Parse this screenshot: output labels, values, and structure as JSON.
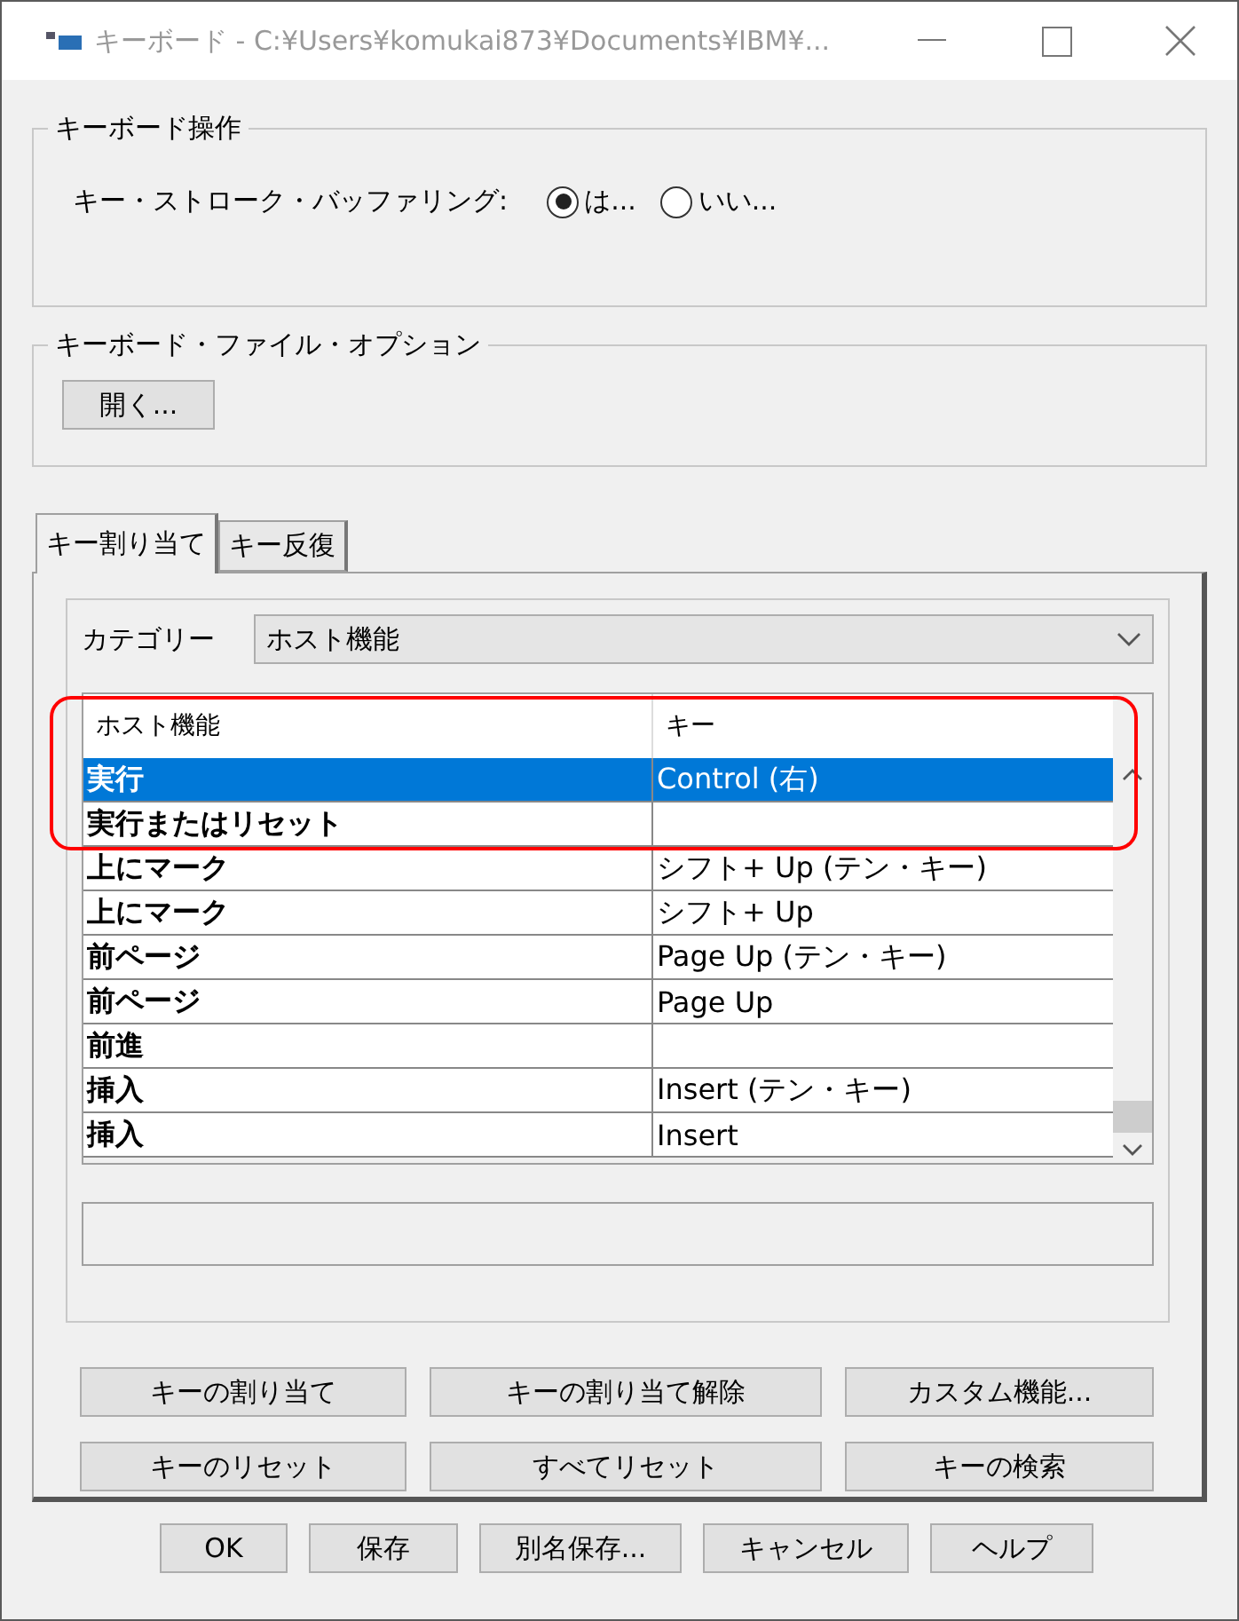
{
  "window": {
    "title": "キーボード - C:¥Users¥komukai873¥Documents¥IBM¥..."
  },
  "keyboard_operation": {
    "legend": "キーボード操作",
    "label": "キー・ストローク・バッファリング:",
    "options": [
      {
        "label": "は...",
        "selected": true
      },
      {
        "label": "いい...",
        "selected": false
      }
    ]
  },
  "file_options": {
    "legend": "キーボード・ファイル・オプション",
    "button": "開く..."
  },
  "tabs": [
    {
      "label": "キー割り当て",
      "selected": true
    },
    {
      "label": "キー反復",
      "selected": false
    }
  ],
  "category": {
    "label": "カテゴリー",
    "value": "ホスト機能"
  },
  "table": {
    "columns": [
      "ホスト機能",
      "キー"
    ],
    "rows": [
      {
        "function": "実行",
        "key": "Control (右)",
        "selected": true
      },
      {
        "function": "実行またはリセット",
        "key": "",
        "selected": false
      },
      {
        "function": "上にマーク",
        "key": "シフト+ Up (テン・キー)",
        "selected": false
      },
      {
        "function": "上にマーク",
        "key": "シフト+ Up",
        "selected": false
      },
      {
        "function": "前ページ",
        "key": "Page Up (テン・キー)",
        "selected": false
      },
      {
        "function": "前ページ",
        "key": "Page Up",
        "selected": false
      },
      {
        "function": "前進",
        "key": "",
        "selected": false
      },
      {
        "function": "挿入",
        "key": "Insert (テン・キー)",
        "selected": false
      },
      {
        "function": "挿入",
        "key": "Insert",
        "selected": false
      }
    ]
  },
  "action_buttons": [
    "キーの割り当て",
    "キーの割り当て解除",
    "カスタム機能...",
    "キーのリセット",
    "すべてリセット",
    "キーの検索"
  ],
  "dialog_buttons": [
    "OK",
    "保存",
    "別名保存...",
    "キャンセル",
    "ヘルプ"
  ]
}
